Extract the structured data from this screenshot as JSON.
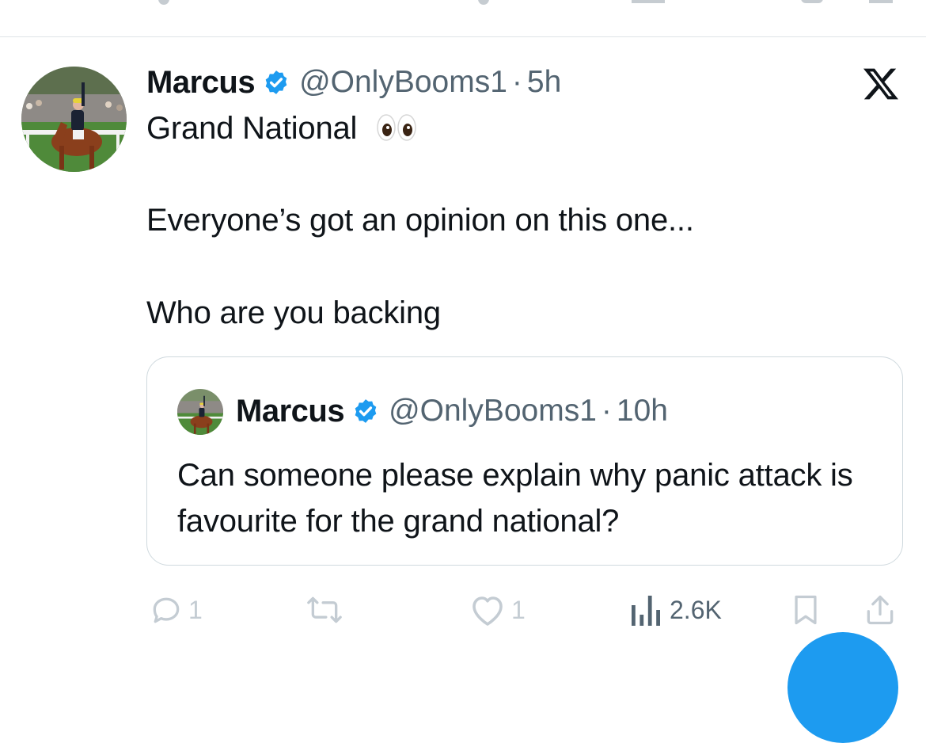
{
  "tweet": {
    "author_name": "Marcus",
    "handle": "@OnlyBooms1",
    "separator": "·",
    "time": "5h",
    "lines": [
      "Grand National",
      "Everyone’s got an opinion on this one...",
      "Who are you backing"
    ]
  },
  "quoted_tweet": {
    "author_name": "Marcus",
    "handle": "@OnlyBooms1",
    "separator": "·",
    "time": "10h",
    "text": "Can someone please explain why panic attack is favourite for the grand national?"
  },
  "actions": {
    "replies": "1",
    "likes": "1",
    "views": "2.6K"
  },
  "icons": {
    "verified": "verified-badge-icon",
    "platform": "x-logo-icon",
    "reply": "reply-icon",
    "retweet": "retweet-icon",
    "like": "heart-icon",
    "views": "views-icon",
    "bookmark": "bookmark-icon",
    "share": "share-icon",
    "eyes": "eyes-emoji"
  },
  "colors": {
    "accent": "#1d9bf0",
    "text": "#0f1419",
    "muted": "#536471",
    "faint_icon": "#c4ccd3",
    "border": "#cfd9de"
  }
}
